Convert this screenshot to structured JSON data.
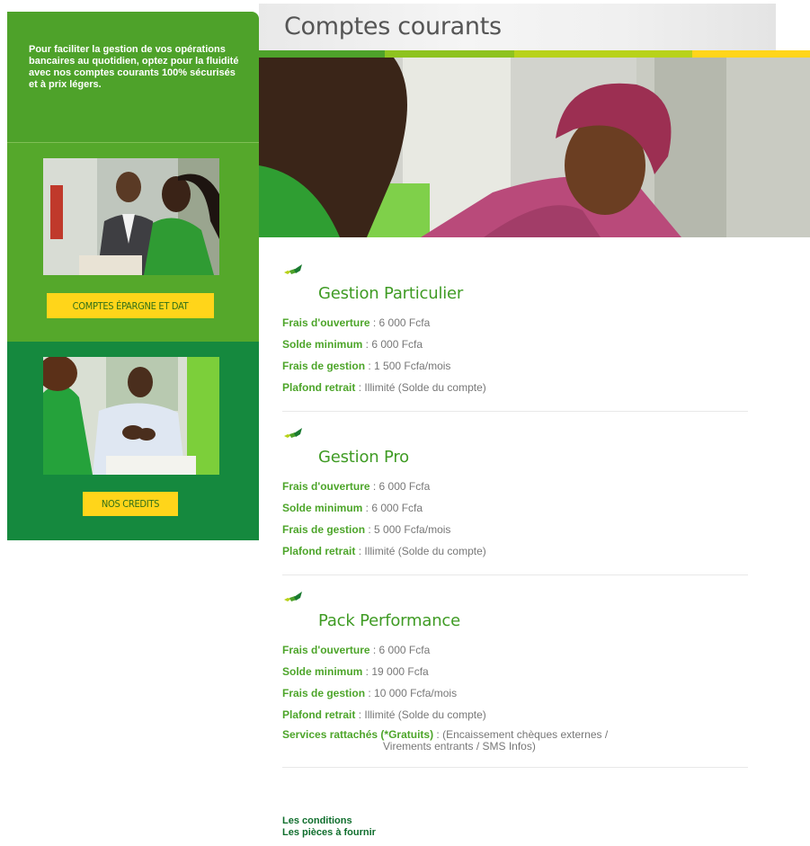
{
  "colors": {
    "green": "#4ea22a",
    "dark_green": "#15893e",
    "yellow": "#ffd51a",
    "label_green": "#4da52a"
  },
  "sidebar": {
    "intro": "Pour faciliter la gestion de vos opérations bancaires au quotidien, optez pour la fluidité avec nos comptes courants 100% sécurisés et à prix légers.",
    "button1": "COMPTES ÉPARGNE ET DAT",
    "button2": "NOS CREDITS"
  },
  "header": {
    "title": "Comptes courants"
  },
  "sections": [
    {
      "title": "Gestion Particulier",
      "rows": [
        {
          "label": "Frais d'ouverture",
          "value": " : 6 000 Fcfa"
        },
        {
          "label": "Solde minimum",
          "value": " : 6 000 Fcfa"
        },
        {
          "label": "Frais de gestion",
          "value": " : 1 500 Fcfa/mois"
        },
        {
          "label": "Plafond retrait",
          "value": " : Illimité (Solde du compte)"
        }
      ]
    },
    {
      "title": "Gestion Pro",
      "rows": [
        {
          "label": "Frais d'ouverture",
          "value": " : 6 000 Fcfa"
        },
        {
          "label": "Solde minimum",
          "value": " : 6 000 Fcfa"
        },
        {
          "label": "Frais de gestion",
          "value": " : 5 000 Fcfa/mois"
        },
        {
          "label": "Plafond retrait",
          "value": " : Illimité (Solde du compte)"
        }
      ]
    },
    {
      "title": "Pack Performance",
      "rows": [
        {
          "label": "Frais d'ouverture",
          "value": " :  6 000 Fcfa"
        },
        {
          "label": "Solde minimum",
          "value": " : 19 000 Fcfa"
        },
        {
          "label": "Frais de gestion",
          "value": " : 10 000 Fcfa/mois"
        },
        {
          "label": "Plafond retrait",
          "value": " : Illimité (Solde du compte)"
        }
      ],
      "services": {
        "label": "Services rattachés (*Gratuits)",
        "value": " :  (Encaissement chèques externes /",
        "value_cont": "Virements entrants / SMS Infos)"
      }
    }
  ],
  "links": {
    "conditions": "Les conditions",
    "pieces": "Les pièces à fournir"
  }
}
